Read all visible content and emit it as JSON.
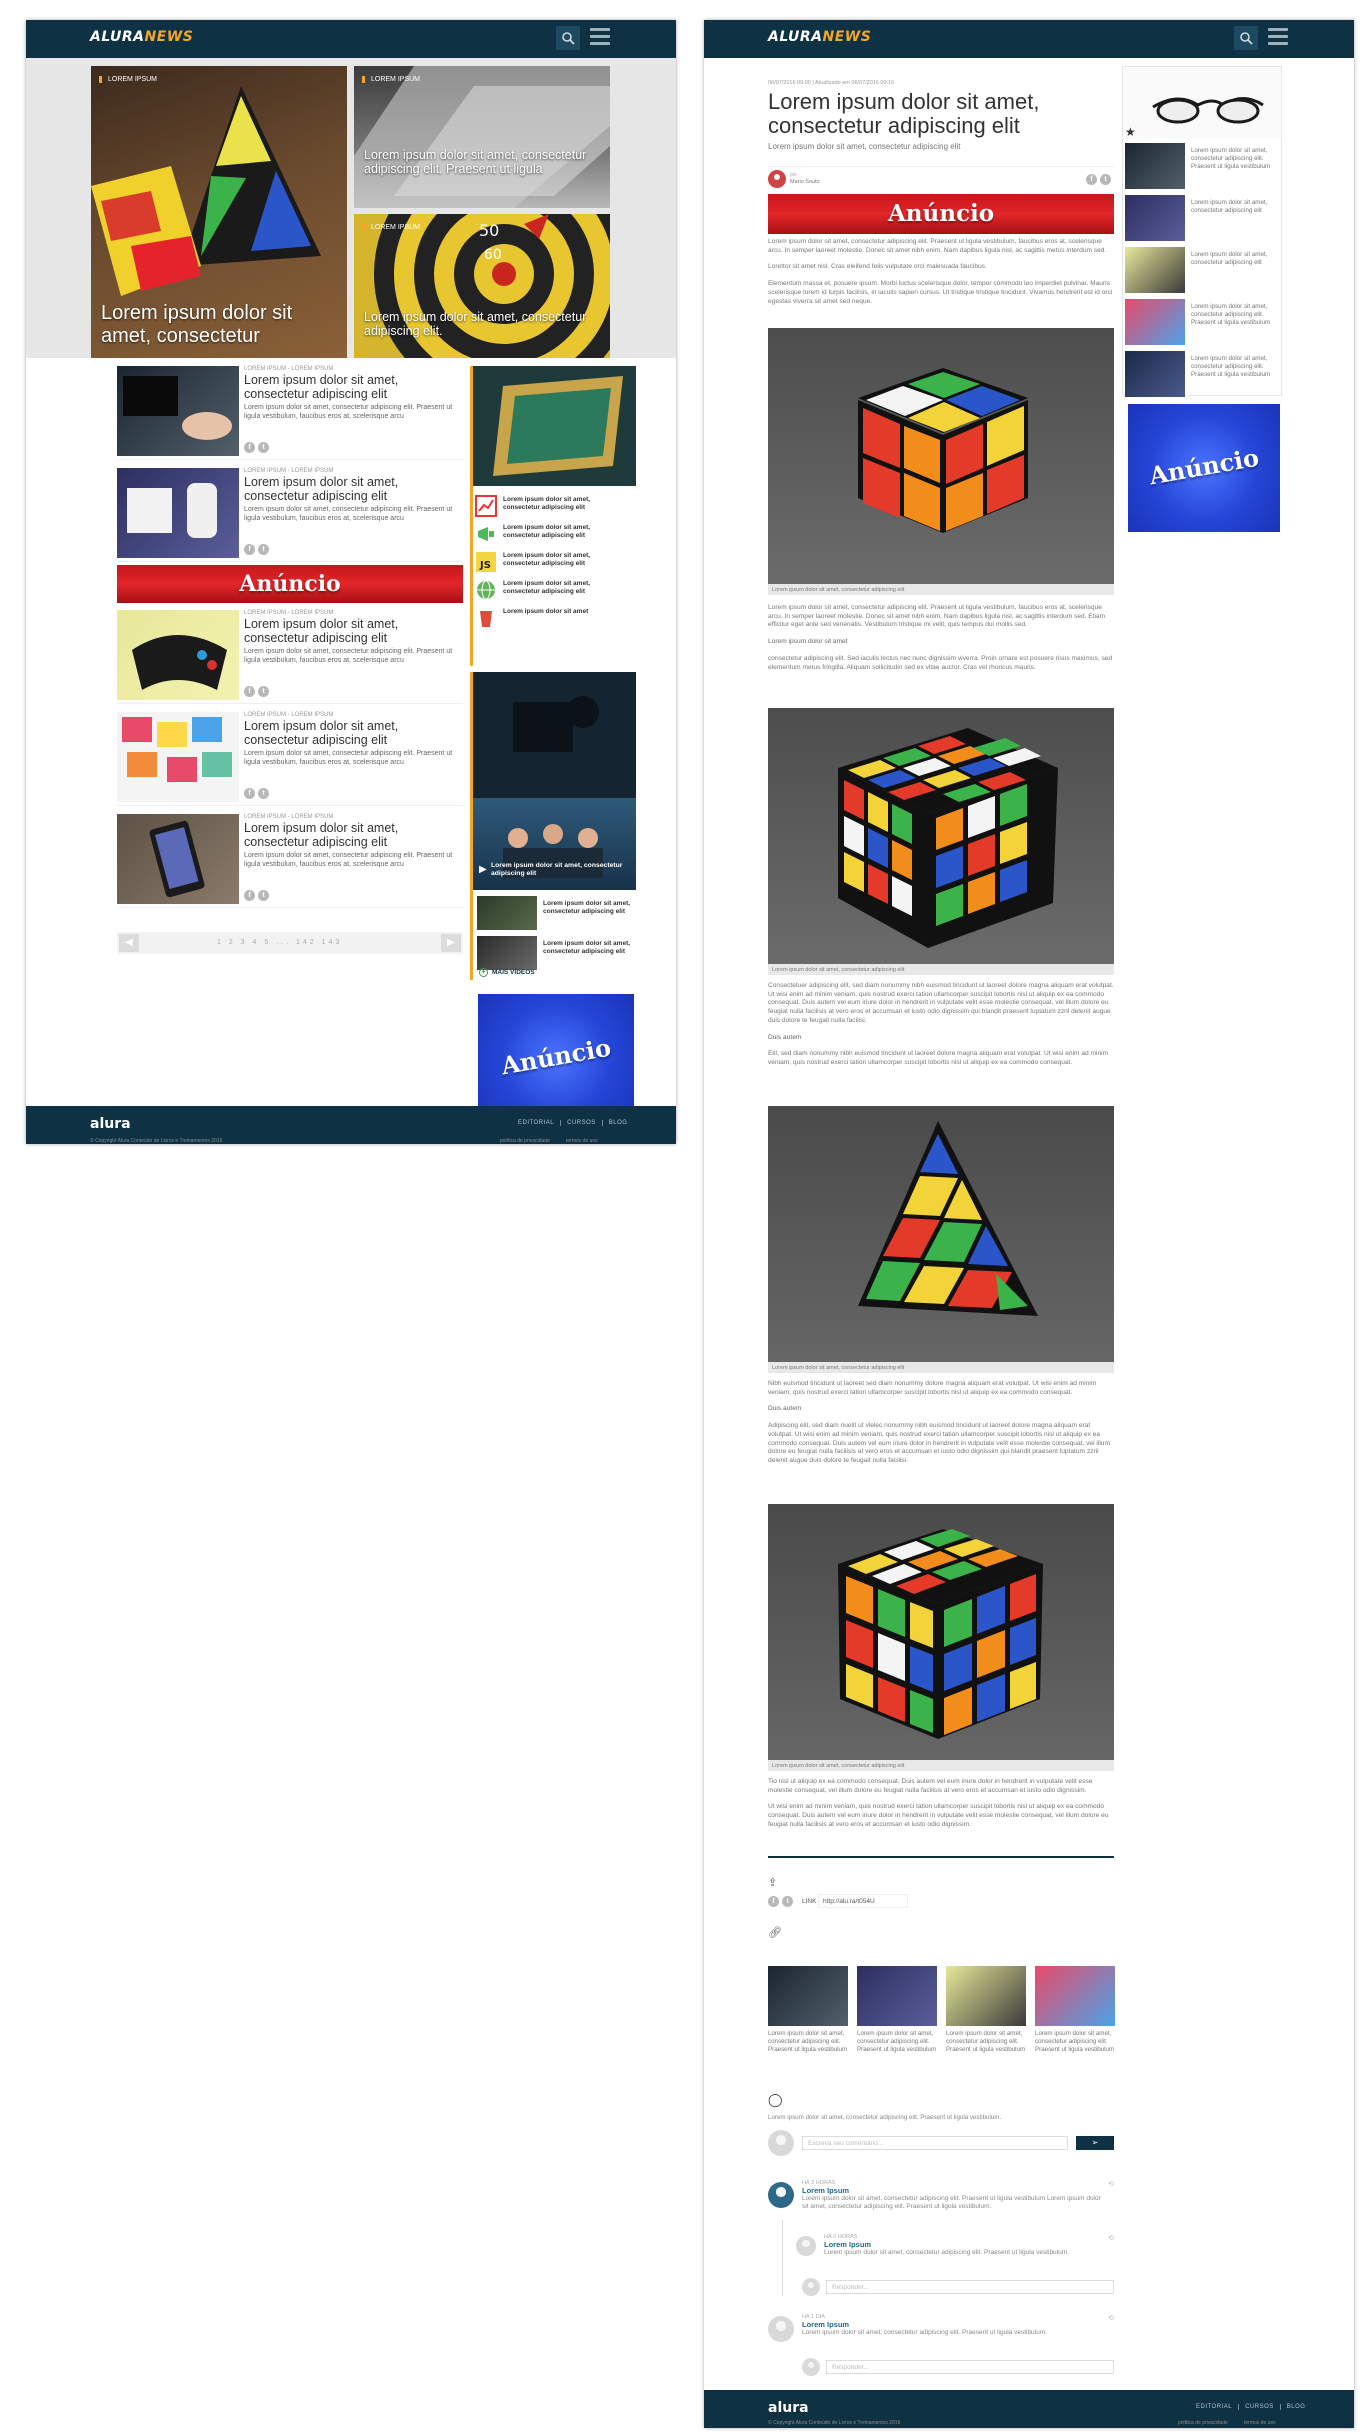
{
  "brand": {
    "logo_alura": "ALURA",
    "logo_news": "NEWS",
    "accent": "#f5a623",
    "navy": "#0e3244"
  },
  "home": {
    "hero": {
      "main": {
        "tag": "LOREM IPSUM",
        "title": "Lorem ipsum dolor sit amet, consectetur"
      },
      "top_right": {
        "tag": "LOREM IPSUM",
        "title": "Lorem ipsum dolor sit amet, consectetur adipiscing elit. Praesent ut ligula"
      },
      "bottom_right": {
        "tag": "LOREM IPSUM",
        "title": "Lorem ipsum dolor sit amet, consectetur adipiscing elit."
      }
    },
    "articles": [
      {
        "category": "LOREM IPSUM - LOREM IPSUM",
        "title": "Lorem ipsum dolor sit amet, consectetur adipiscing elit",
        "desc": "Lorem ipsum dolor sit amet, consectetur adipiscing elit. Praesent ut ligula vestibulum, faucibus eros at, scelerisque arcu"
      },
      {
        "category": "LOREM IPSUM - LOREM IPSUM",
        "title": "Lorem ipsum dolor sit amet, consectetur adipiscing elit",
        "desc": "Lorem ipsum dolor sit amet, consectetur adipiscing elit. Praesent ut ligula vestibulum, faucibus eros at, scelerisque arcu"
      },
      {
        "category": "LOREM IPSUM - LOREM IPSUM",
        "title": "Lorem ipsum dolor sit amet, consectetur adipiscing elit",
        "desc": "Lorem ipsum dolor sit amet, consectetur adipiscing elit. Praesent ut ligula vestibulum, faucibus eros at, scelerisque arcu"
      },
      {
        "category": "LOREM IPSUM - LOREM IPSUM",
        "title": "Lorem ipsum dolor sit amet, consectetur adipiscing elit",
        "desc": "Lorem ipsum dolor sit amet, consectetur adipiscing elit. Praesent ut ligula vestibulum, faucibus eros at, scelerisque arcu"
      },
      {
        "category": "LOREM IPSUM - LOREM IPSUM",
        "title": "Lorem ipsum dolor sit amet, consectetur adipiscing elit",
        "desc": "Lorem ipsum dolor sit amet, consectetur adipiscing elit. Praesent ut ligula vestibulum, faucibus eros at, scelerisque arcu"
      }
    ],
    "ad_label": "Anúncio",
    "pagination": {
      "prev": "◀",
      "next": "▶",
      "pages": "1  2  3  4  5  ...  142  143"
    },
    "sidebar_list": [
      "Lorem ipsum dolor sit amet, consectetur adipiscing elit",
      "Lorem ipsum dolor sit amet, consectetur adipiscing elit",
      "Lorem ipsum dolor sit amet, consectetur adipiscing elit",
      "Lorem ipsum dolor sit amet, consectetur adipiscing elit",
      "Lorem ipsum dolor sit amet"
    ],
    "video_feature": "Lorem ipsum dolor sit amet, consectetur adipiscing elit",
    "videos": [
      "Lorem ipsum dolor sit amet, consectetur adipiscing elit",
      "Lorem ipsum dolor sit amet, consectetur adipiscing elit"
    ],
    "more_videos": "MAIS VÍDEOS"
  },
  "footer": {
    "logo": "alura",
    "links": [
      "EDITORIAL",
      "CURSOS",
      "BLOG"
    ],
    "copyright": "© Copyright Alura Conteúdo de Livros e Treinamentos 2016",
    "policy": "política de privacidade",
    "terms": "termos de uso"
  },
  "article": {
    "meta": "06/07/2016 09:00 | Atualizado em 06/07/2016 09:16",
    "title": "Lorem ipsum dolor sit amet, consectetur adipiscing elit",
    "subtitle": "Lorem ipsum dolor sit amet, consectetur adipiscing elit",
    "author_by": "por",
    "author_name": "Mario Souto",
    "ad_label": "Anúncio",
    "p1": "Lorem ipsum dolor sit amet, consectetur adipiscing elit. Praesent ut ligula vestibulum, faucibus eros at, scelerisque arcu. In semper laoreet molestie. Donec sit amet nibh enim. Nam dapibus ligula nisl, ac sagittis metus interdum sed.",
    "p2": "Lorettor sit amet nisl. Cras eleifend felis vulputate orci malesuada faucibus.",
    "p3": "Elementum massa et, posuere ipsum. Morbi luctus scelerisque dolor, tempor commodo leo imperdiet pulvinar. Mauris scelerisque lorem id turpis facilisis, in iaculis sapien cursus. Ut tristique tristique tincidunt. Vivamus hendrerit est id orci egestas viverra sit amet sed neque.",
    "caption": "Lorem ipsum dolor sit amet, consectetur adipiscing elit",
    "p4": "Lorem ipsum dolor sit amet, consectetur adipiscing elit. Praesent ut ligula vestibulum, faucibus eros at, scelerisque arcu. In semper laoreet molestie. Donec sit amet nibh enim. Nam dapibus ligula nisl, ac sagittis interdum sed. Etiam efficitur eget ante sed venenatis. Vestibulum tristique mi velit, quis tempus dui mollis sed.",
    "h1": "Lorem ipsum dolor sit amet",
    "p5": "consectetur adipiscing elit. Sed iaculis lectus nec nunc dignissim viverra. Proin ornare est posuere risus maximus, sed elementum metus fringilla. Aliquam sollicitudin sed ex vitae auctor. Cras vel rhoncus mauris.",
    "p6": "Consectetuer adipiscing elit, sed diam nonummy nibh euismod tincidunt ut laoreet dolore magna aliquam erat volutpat. Ut wisi enim ad minim veniam, quis nostrud exerci tation ullamcorper suscipit lobortis nisl ut aliquip ex ea commodo consequat. Duis autem vel eum iriure dolor in hendrerit in vulputate velit esse molestie consequat, vel illum dolore eu feugiat nulla facilisis at vero eros et accumsan et iusto odio dignissim qui blandit praesent luptatum zzril delenit augue duis dolore te feugait nulla facilisi.",
    "h2": "Duis autem",
    "p7": "Elit, sed diam nonummy nibh euismod tincidunt ut laoreet dolore magna aliquam erat volutpat. Ut wisi enim ad minim veniam, quis nostrud exerci tation ullamcorper suscipit lobortis nisl ut aliquip ex ea commodo consequat.",
    "p8": "Nibh euismod tincidunt ut laoreet sed diam nonummy dolore magna aliquam erat volutpat. Ut wisi enim ad minim veniam, quis nostrud exerci tation ullamcorper suscipit lobortis nisl ut aliquip ex ea commodo consequat.",
    "h3": "Duis autem",
    "p9": "Adipiscing elit, sed diam nuelit ut vlelec nonummy nibh euismod tincidunt ut laoreet dolore magna aliquam erat volutpat. Ut wisi enim ad minim veniam, quis nostrud exerci tation ullamcorper suscipit lobortis nisl ut aliquip ex ea commodo consequat. Duis autem vel eum iriure dolor in hendrerit in vulputate velit esse molestie consequat, vel illum dolore eu feugiat nulla facilisis at vero eros et accumsan et iusto odio dignissim qui blandit praesent luptatum zzril delenit augue duis dolore te feugait nulla facilisi.",
    "p10": "Tio nisl ut aliquip ex ea commodo consequat. Duis autem vel eum iriure dolor in hendrerit in vulputate velit esse molestie consequat, vel illum dolore eu feugiat nulla facilisis at vero eros et accumsan et iusto odio dignissim.",
    "p11": "Ut wisi enim ad minim veniam, quis nostrud exerci tation ullamcorper suscipit lobortis nisl ut aliquip ex ea commodo consequat. Duis autem vel eum iriure dolor in hendrerit in vulputate velit esse molestie consequat, vel illum dolore eu feugiat nulla facilisis at vero eros et accumsan et iusto odio dignissim.",
    "link_label": "LINK",
    "link_url": "http://alu.ra/t054U",
    "related": [
      "Lorem ipsum dolor sit amet, consectetur adipiscing elit. Praesent ut ligula vestibulum",
      "Lorem ipsum dolor sit amet, consectetur adipiscing elit. Praesent ut ligula vestibulum",
      "Lorem ipsum dolor sit amet, consectetur adipiscing elit. Praesent ut ligula vestibulum",
      "Lorem ipsum dolor sit amet, consectetur adipiscing elit. Praesent ut ligula vestibulum"
    ],
    "comments_intro": "Lorem ipsum dolor sit amet, consectetur adipiscing elit. Praesent ut ligula vestibulum.",
    "comment_placeholder": "Escreva seu comentário...",
    "reply_placeholder": "Responder...",
    "comments": [
      {
        "time": "HÁ 3 HORAS",
        "author": "Lorem Ipsum",
        "text": "Lorem ipsum dolor sit amet, consectetur adipiscing elit. Praesent ut ligula vestibulum Lorem ipsum dolor sit amet, consectetur adipiscing elit. Praesent ut ligula vestibulum."
      },
      {
        "time": "HÁ 2 HORAS",
        "author": "Lorem Ipsum",
        "text": "Lorem ipsum dolor sit amet, consectetur adipiscing elit. Praesent ut ligula vestibulum."
      },
      {
        "time": "HÁ 1 DIA",
        "author": "Lorem Ipsum",
        "text": "Lorem ipsum dolor sit amet, consectetur adipiscing elit. Praesent ut ligula vestibulum."
      }
    ],
    "side_list": [
      "Lorem ipsum dolor sit amet, consectetur adipiscing elit. Praesent ut ligula vestibulum",
      "Lorem ipsum dolor sit amet, consectetur adipiscing elit",
      "Lorem ipsum dolor sit amet, consectetur adipiscing elit",
      "Lorem ipsum dolor sit amet, consectetur adipiscing elit. Praesent ut ligula vestibulum",
      "Lorem ipsum dolor sit amet, consectetur adipiscing elit. Praesent ut ligula vestibulum"
    ]
  }
}
